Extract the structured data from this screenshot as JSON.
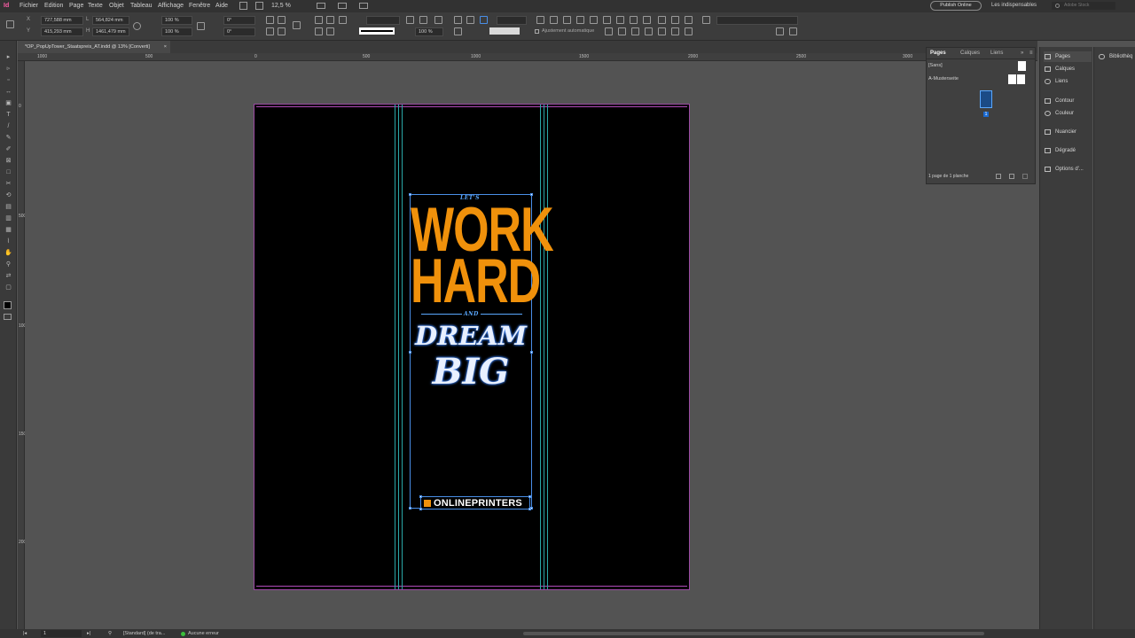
{
  "app": {
    "logo": "Id"
  },
  "menu": [
    "Fichier",
    "Edition",
    "Page",
    "Texte",
    "Objet",
    "Tableau",
    "Affichage",
    "Fenêtre",
    "Aide"
  ],
  "zoom": "12,5 %",
  "topright": {
    "publish": "Publish Online",
    "workspace": "Les indispensables",
    "search_placeholder": "Adobe Stock"
  },
  "control": {
    "x": "727,588 mm",
    "y": "415,293 mm",
    "w": "564,824 mm",
    "h": "1461,479 mm",
    "scale_x": "100 %",
    "scale_y": "100 %",
    "angle": "0°",
    "shear": "0°",
    "stroke_pct": "100 %",
    "auto_fit": "Ajustement automatique"
  },
  "document_tab": "*OP_PopUpTower_Staatspreis_AT.indd @ 13% [Converti]",
  "ruler_h": [
    "1000",
    "500",
    "0",
    "500",
    "1000",
    "1500",
    "2000",
    "2500",
    "3000"
  ],
  "ruler_v": [
    "0",
    "500",
    "1000",
    "1500",
    "2000"
  ],
  "artwork": {
    "lets": "LET'S",
    "work": "WORK",
    "hard": "HARD",
    "and": "AND",
    "dream": "DREAM",
    "big": "BIG",
    "logo": "ONLINEPRINTERS"
  },
  "pages_panel": {
    "tabs": [
      "Pages",
      "Calques",
      "Liens"
    ],
    "none": "[Sans]",
    "master": "A-Mustersei​te",
    "page_number": "1",
    "footer": "1 page de 1 planche"
  },
  "dock": [
    "Pages",
    "Calques",
    "Liens",
    "Contour",
    "Couleur",
    "Nuancier",
    "Dégradé",
    "Options d'..."
  ],
  "dock_far": "Bibliothèq",
  "status": {
    "page": "1",
    "profile": "[Standard] (de tra...",
    "errors": "Aucune erreur"
  },
  "colors": {
    "accent_orange": "#f0910b",
    "accent_blue": "#5aa8ff",
    "guide": "#2aa7a7",
    "margin": "#b04ab8"
  }
}
